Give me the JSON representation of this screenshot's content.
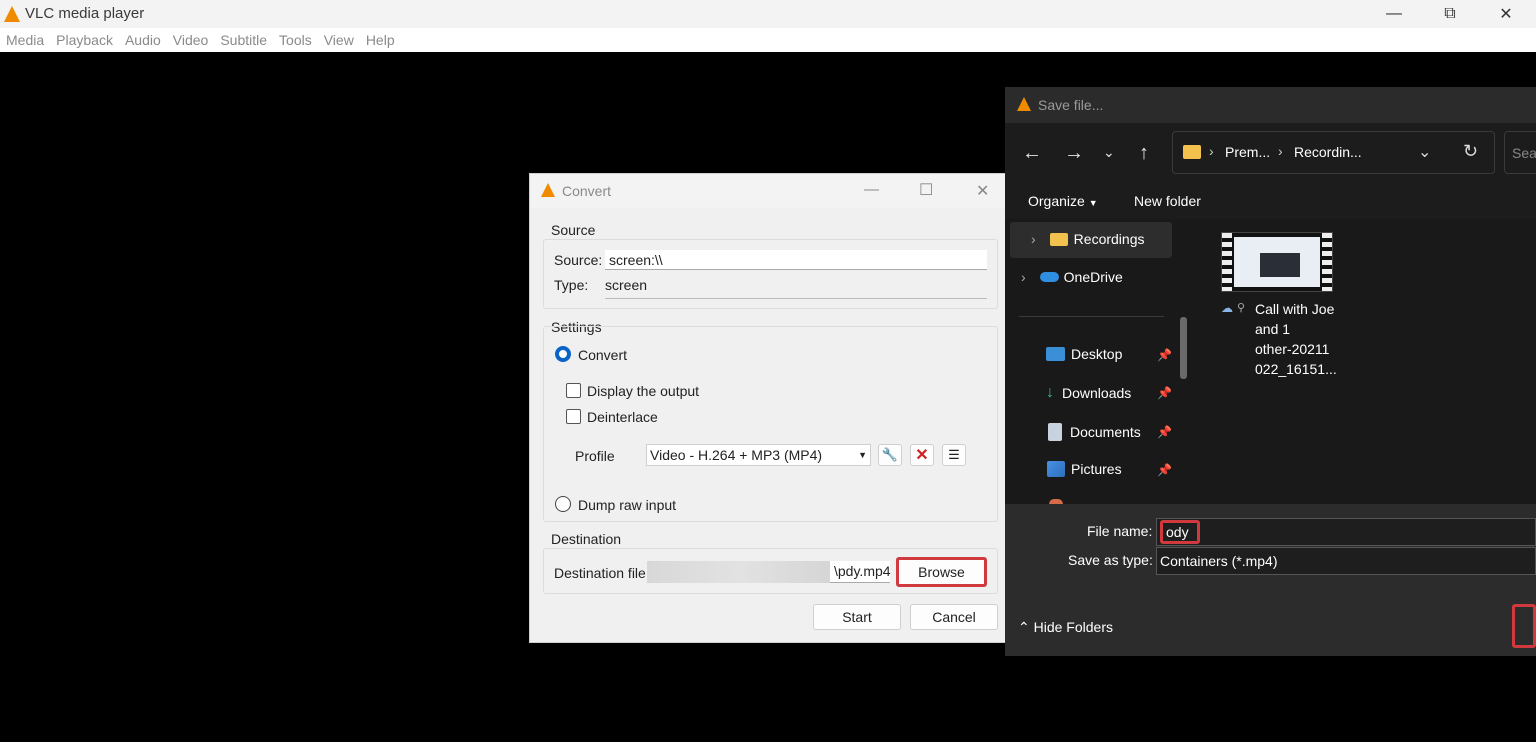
{
  "vlc": {
    "title": "VLC media player",
    "menu": [
      "Media",
      "Playback",
      "Audio",
      "Video",
      "Subtitle",
      "Tools",
      "View",
      "Help"
    ],
    "window_buttons": {
      "minimize": "—",
      "restore": "⧉",
      "close": "✕"
    }
  },
  "convert": {
    "title": "Convert",
    "window_buttons": {
      "minimize": "—",
      "maximize": "☐",
      "close": "✕"
    },
    "source_group": "Source",
    "source_label": "Source:",
    "source_value": "screen:\\\\",
    "type_label": "Type:",
    "type_value": "screen",
    "settings_group": "Settings",
    "convert_option": "Convert",
    "display_output": "Display the output",
    "deinterlace": "Deinterlace",
    "profile_label": "Profile",
    "profile_value": "Video - H.264 + MP3 (MP4)",
    "dump_raw": "Dump raw input",
    "destination_group": "Destination",
    "destination_label": "Destination file:",
    "destination_value": "\\pdy.mp4",
    "browse": "Browse",
    "start": "Start",
    "cancel": "Cancel"
  },
  "save_dialog": {
    "title": "Save file...",
    "breadcrumb": [
      "Prem...",
      "Recordin..."
    ],
    "search_placeholder": "Sea",
    "organize": "Organize",
    "new_folder": "New folder",
    "sidebar": [
      {
        "label": "Recordings",
        "pinned": false
      },
      {
        "label": "OneDrive",
        "pinned": false
      },
      {
        "label": "Desktop",
        "pinned": true
      },
      {
        "label": "Downloads",
        "pinned": true
      },
      {
        "label": "Documents",
        "pinned": true
      },
      {
        "label": "Pictures",
        "pinned": true
      }
    ],
    "file_item": {
      "line1": "Call with Joe",
      "line2": "and 1",
      "line3": "other-20211",
      "line4": "022_16151..."
    },
    "file_name_label": "File name:",
    "file_name_value": "ody",
    "save_as_label": "Save as type:",
    "save_as_value": "Containers (*.mp4)",
    "hide_folders": "Hide Folders"
  },
  "colors": {
    "vlc_orange": "#f08a00",
    "highlight": "#d0393e",
    "accent_blue": "#0a64c8",
    "folder": "#f2c14e",
    "onedrive": "#2f8ee0"
  }
}
